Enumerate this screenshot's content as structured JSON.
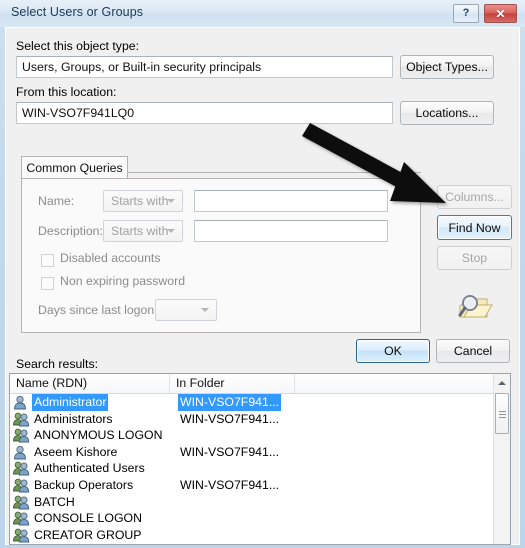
{
  "window": {
    "title": "Select Users or Groups",
    "help_button": "?",
    "close_button": "✕",
    "help_icon_name": "help-icon",
    "close_icon_name": "close-icon"
  },
  "object_type": {
    "label": "Select this object type:",
    "value": "Users, Groups, or Built-in security principals",
    "button": "Object Types..."
  },
  "location": {
    "label": "From this location:",
    "value": "WIN-VSO7F941LQ0",
    "button": "Locations..."
  },
  "queries": {
    "tab_label": "Common Queries",
    "name_label": "Name:",
    "name_operator": "Starts with",
    "name_value": "",
    "description_label": "Description:",
    "description_operator": "Starts with",
    "description_value": "",
    "disabled_accounts_label": "Disabled accounts",
    "disabled_accounts_checked": false,
    "non_expiring_label": "Non expiring password",
    "non_expiring_checked": false,
    "days_label": "Days since last logon:",
    "days_value": ""
  },
  "side_buttons": {
    "columns": "Columns...",
    "columns_enabled": false,
    "find_now": "Find Now",
    "find_now_enabled": true,
    "stop": "Stop",
    "stop_enabled": false
  },
  "dialog_buttons": {
    "ok": "OK",
    "cancel": "Cancel"
  },
  "results": {
    "label": "Search results:",
    "columns": [
      "Name (RDN)",
      "In Folder"
    ],
    "rows": [
      {
        "name": "Administrator",
        "folder": "WIN-VSO7F941...",
        "icon": "user-icon",
        "selected": true
      },
      {
        "name": "Administrators",
        "folder": "WIN-VSO7F941...",
        "icon": "group-icon",
        "selected": false
      },
      {
        "name": "ANONYMOUS LOGON",
        "folder": "",
        "icon": "group-icon",
        "selected": false
      },
      {
        "name": "Aseem Kishore",
        "folder": "WIN-VSO7F941...",
        "icon": "user-icon",
        "selected": false
      },
      {
        "name": "Authenticated Users",
        "folder": "",
        "icon": "group-icon",
        "selected": false
      },
      {
        "name": "Backup Operators",
        "folder": "WIN-VSO7F941...",
        "icon": "group-icon",
        "selected": false
      },
      {
        "name": "BATCH",
        "folder": "",
        "icon": "group-icon",
        "selected": false
      },
      {
        "name": "CONSOLE LOGON",
        "folder": "",
        "icon": "group-icon",
        "selected": false
      },
      {
        "name": "CREATOR GROUP",
        "folder": "",
        "icon": "group-icon",
        "selected": false
      }
    ]
  },
  "annotation": {
    "arrow_icon": "pointer-arrow-icon",
    "points_to": "Find Now"
  },
  "colors": {
    "selection": "#3399ff",
    "titlebar": "#d8e7f3",
    "close_button": "#c33f3a",
    "dialog_bg": "#f0f0f0",
    "focus_border": "#3c7fb1"
  }
}
